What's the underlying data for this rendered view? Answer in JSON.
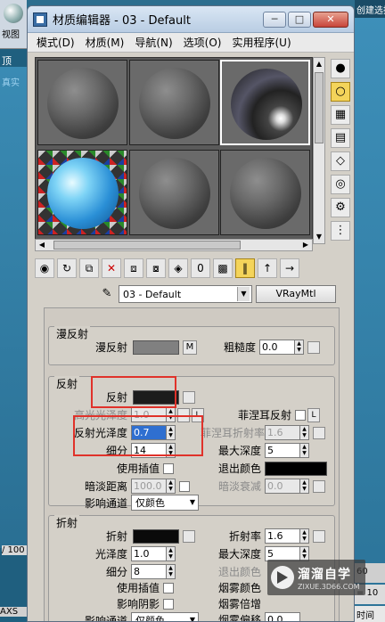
{
  "background": {
    "left_top_label": "视图",
    "left_label_1": "顶",
    "left_label_2": "真实",
    "left_label_3": "/ 100",
    "left_label_4": "AXS",
    "right_topbar": "创建选择集",
    "right_b1": "60",
    "right_b2": "= 10",
    "right_b3": "时间"
  },
  "window": {
    "title": "材质编辑器 - 03 - Default",
    "minimize_label": "─",
    "maximize_label": "□",
    "close_label": "✕"
  },
  "menu": [
    {
      "label": "模式(D)"
    },
    {
      "label": "材质(M)"
    },
    {
      "label": "导航(N)"
    },
    {
      "label": "选项(O)"
    },
    {
      "label": "实用程序(U)"
    }
  ],
  "material_name": "03 - Default",
  "material_type": "VRayMtl",
  "diffuse": {
    "title": "漫反射",
    "diffuse_label": "漫反射",
    "diffuse_color": "#808080",
    "map_button": "M",
    "roughness_label": "粗糙度",
    "roughness_value": "0.0"
  },
  "reflection": {
    "title": "反射",
    "reflect_label": "反射",
    "reflect_color": "#1c1c1c",
    "hilight_gloss_label": "高光光泽度",
    "hilight_gloss_value": "1.0",
    "lock_label": "L",
    "fresnel_label": "菲涅耳反射",
    "refl_gloss_label": "反射光泽度",
    "refl_gloss_value": "0.7",
    "fresnel_ior_label": "菲涅耳折射率",
    "fresnel_ior_value": "1.6",
    "subdivs_label": "细分",
    "subdivs_value": "14",
    "max_depth_label": "最大深度",
    "max_depth_value": "5",
    "use_interp_label": "使用插值",
    "exit_color_label": "退出颜色",
    "exit_color": "#000000",
    "dim_dist_label": "暗淡距离",
    "dim_dist_value": "100.0",
    "dim_falloff_label": "暗淡衰减",
    "dim_falloff_value": "0.0",
    "affect_channels_label": "影响通道",
    "affect_channels_value": "仅颜色"
  },
  "refraction": {
    "title": "折射",
    "refract_label": "折射",
    "refract_color": "#0a0a0a",
    "ior_label": "折射率",
    "ior_value": "1.6",
    "gloss_label": "光泽度",
    "gloss_value": "1.0",
    "max_depth_label": "最大深度",
    "max_depth_value": "5",
    "subdivs_label": "细分",
    "subdivs_value": "8",
    "exit_color_label": "退出颜色",
    "use_interp_label": "使用插值",
    "fog_color_label": "烟雾颜色",
    "affect_shadows_label": "影响阴影",
    "fog_mult_label": "烟雾倍增",
    "affect_channels_label": "影响通道",
    "affect_channels_value": "仅颜色",
    "fog_bias_label": "烟雾偏移",
    "fog_bias_value": "0.0"
  },
  "watermark": {
    "title": "溜溜自学",
    "subtitle": "ZIXUE.3D66.COM"
  }
}
